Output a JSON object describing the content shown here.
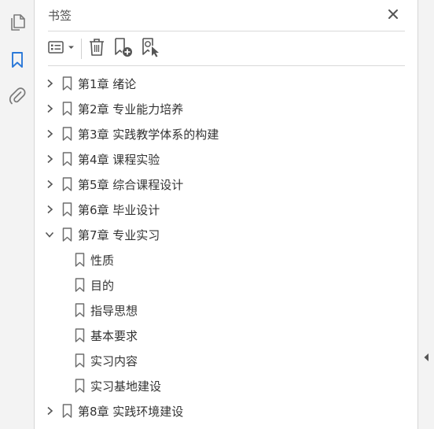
{
  "rail": {
    "items": [
      {
        "icon": "pages-icon",
        "label": "Pages"
      },
      {
        "icon": "bookmark-icon",
        "label": "Bookmarks"
      },
      {
        "icon": "attachment-icon",
        "label": "Attachments"
      }
    ],
    "active_color": "#2a78d8",
    "inactive_color": "#7a7a7a"
  },
  "panel": {
    "title": "书签",
    "close_icon": "close-icon"
  },
  "toolbar": {
    "buttons": [
      {
        "icon": "bookmark-options-icon"
      },
      {
        "icon": "delete-icon"
      },
      {
        "icon": "new-bookmark-icon"
      },
      {
        "icon": "bookmark-from-selection-icon"
      }
    ]
  },
  "bookmarks": [
    {
      "label": "第1章  绪论",
      "expanded": false
    },
    {
      "label": "第2章  专业能力培养",
      "expanded": false
    },
    {
      "label": "第3章  实践教学体系的构建",
      "expanded": false
    },
    {
      "label": "第4章  课程实验",
      "expanded": false
    },
    {
      "label": "第5章  综合课程设计",
      "expanded": false
    },
    {
      "label": "第6章  毕业设计",
      "expanded": false
    },
    {
      "label": "第7章  专业实习",
      "expanded": true,
      "children": [
        {
          "label": "性质"
        },
        {
          "label": "目的"
        },
        {
          "label": "指导思想"
        },
        {
          "label": "基本要求"
        },
        {
          "label": "实习内容"
        },
        {
          "label": "实习基地建设"
        }
      ]
    },
    {
      "label": "第8章  实践环境建设",
      "expanded": false
    }
  ]
}
